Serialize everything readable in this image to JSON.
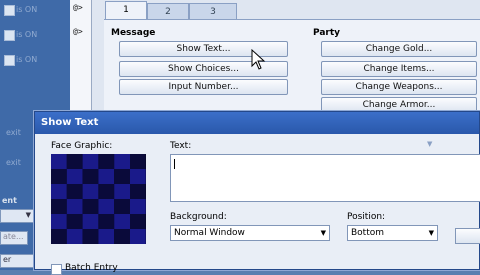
{
  "left_panel": {
    "rows": [
      "is ON",
      "is ON",
      "is ON"
    ],
    "blur_labels": [
      "ent",
      "ate...",
      "er"
    ],
    "bottom_texts": [
      "exit",
      "exit"
    ]
  },
  "event_list": {
    "lines": [
      "@>",
      "@>"
    ]
  },
  "command_window": {
    "tabs": [
      "1",
      "2",
      "3"
    ],
    "active_tab": "1",
    "message_group": {
      "title": "Message",
      "buttons": [
        "Show Text...",
        "Show Choices...",
        "Input Number..."
      ]
    },
    "party_group": {
      "title": "Party",
      "buttons": [
        "Change Gold...",
        "Change Items...",
        "Change Weapons...",
        "Change Armor..."
      ]
    }
  },
  "dialog": {
    "title": "Show Text",
    "face_label": "Face Graphic:",
    "text_label": "Text:",
    "text_value": "",
    "background_label": "Background:",
    "background_value": "Normal Window",
    "position_label": "Position:",
    "position_value": "Bottom",
    "batch_label": "Batch Entry",
    "face_colors": {
      "dark": "#0a0a3a",
      "light": "#1a1a8a"
    }
  }
}
